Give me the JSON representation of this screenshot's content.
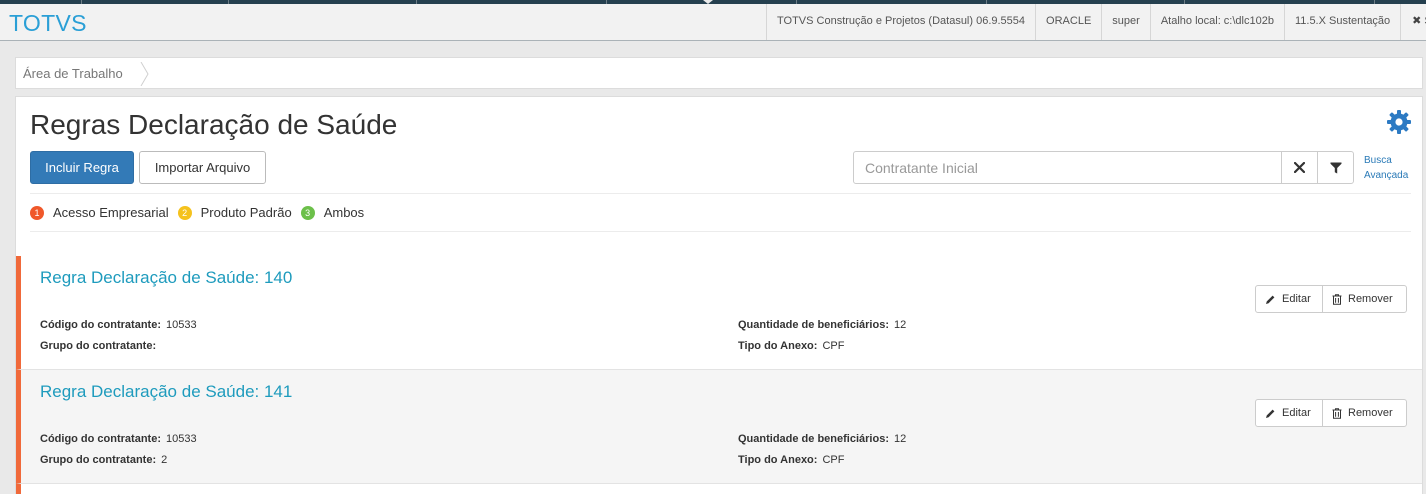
{
  "app": {
    "brand": "TOTVS"
  },
  "topbar": {
    "product": "TOTVS Construção e Projetos (Datasul) 06.9.5554",
    "database": "ORACLE",
    "user": "super",
    "shortcut": "Atalho local: c:\\dlc102b",
    "version": "11.5.X Sustentação",
    "exit": "Sa"
  },
  "breadcrumb": {
    "item": "Área de Trabalho"
  },
  "page": {
    "title": "Regras Declaração de Saúde",
    "include_button": "Incluir Regra",
    "import_button": "Importar Arquivo",
    "search": {
      "placeholder": "Contratante Inicial",
      "value": ""
    },
    "advanced_search_line1": "Busca",
    "advanced_search_line2": "Avançada"
  },
  "legend": [
    {
      "number": "1",
      "label": "Acesso Empresarial",
      "color": "#f0582a"
    },
    {
      "number": "2",
      "label": "Produto Padrão",
      "color": "#f5c21d"
    },
    {
      "number": "3",
      "label": "Ambos",
      "color": "#6cc04a"
    }
  ],
  "labels": {
    "codigo": "Código do contratante:",
    "grupo": "Grupo do contratante:",
    "quantidade": "Quantidade de beneficiários:",
    "tipo": "Tipo do Anexo:",
    "edit": "Editar",
    "remove": "Remover"
  },
  "rules": [
    {
      "title": "Regra Declaração de Saúde: 140",
      "codigo": "10533",
      "grupo": "",
      "quantidade": "12",
      "tipo": "CPF"
    },
    {
      "title": "Regra Declaração de Saúde: 141",
      "codigo": "10533",
      "grupo": "2",
      "quantidade": "12",
      "tipo": "CPF"
    }
  ],
  "colors": {
    "accent": "#337ab7",
    "brand": "#2a9fd6",
    "card_border": "#f0693a",
    "title_link": "#1e9bbd"
  }
}
